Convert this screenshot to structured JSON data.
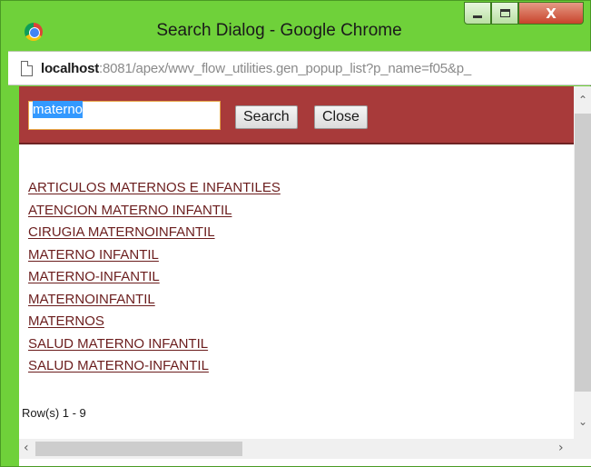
{
  "window": {
    "title": "Search Dialog - Google Chrome",
    "close_glyph": "X",
    "accent_color": "#6fd13a"
  },
  "address_bar": {
    "host": "localhost",
    "path": ":8081/apex/wwv_flow_utilities.gen_popup_list?p_name=f05&p_"
  },
  "search": {
    "query": "materno",
    "search_label": "Search",
    "close_label": "Close",
    "bar_color": "#a83a3a"
  },
  "results": [
    "ARTICULOS MATERNOS E INFANTILES",
    "ATENCION MATERNO INFANTIL",
    "CIRUGIA MATERNOINFANTIL",
    "MATERNO INFANTIL",
    "MATERNO-INFANTIL",
    "MATERNOINFANTIL",
    "MATERNOS",
    "SALUD MATERNO INFANTIL",
    "SALUD MATERNO-INFANTIL"
  ],
  "footer": {
    "row_count": "Row(s) 1 - 9"
  }
}
